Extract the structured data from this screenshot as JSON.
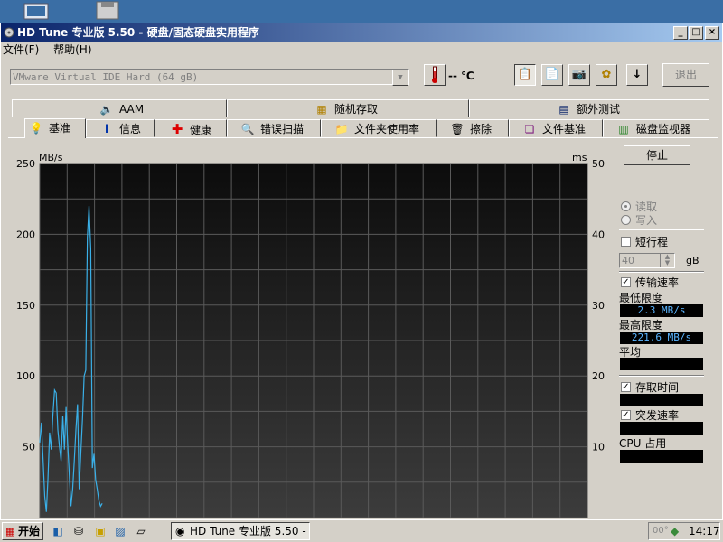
{
  "app": {
    "title": "HD Tune 专业版 5.50 - 硬盘/固态硬盘实用程序"
  },
  "menu": [
    "文件(F)",
    "帮助(H)"
  ],
  "toolbar": {
    "drive": "VMware Virtual IDE Hard (64 gB)",
    "temperature": "-- ℃",
    "exit_label": "退出"
  },
  "tabs_top": [
    {
      "label": "AAM",
      "icon": "speaker-icon"
    },
    {
      "label": "随机存取",
      "icon": "random-access-icon"
    },
    {
      "label": "额外测试",
      "icon": "extra-tests-icon"
    }
  ],
  "tabs_bottom": [
    {
      "label": "基准",
      "icon": "lightbulb-icon",
      "active": true
    },
    {
      "label": "信息",
      "icon": "info-icon"
    },
    {
      "label": "健康",
      "icon": "health-cross-icon"
    },
    {
      "label": "错误扫描",
      "icon": "magnifier-icon"
    },
    {
      "label": "文件夹使用率",
      "icon": "folder-icon"
    },
    {
      "label": "擦除",
      "icon": "trash-icon"
    },
    {
      "label": "文件基准",
      "icon": "file-benchmark-icon"
    },
    {
      "label": "磁盘监视器",
      "icon": "disk-monitor-icon"
    }
  ],
  "right_panel": {
    "stop_label": "停止",
    "read_label": "读取",
    "write_label": "写入",
    "short_stroke_label": "短行程",
    "short_stroke_value": "40",
    "short_stroke_unit": "gB",
    "transfer_rate_label": "传输速率",
    "min_label": "最低限度",
    "min_value": "2.3 MB/s",
    "max_label": "最高限度",
    "max_value": "221.6 MB/s",
    "avg_label": "平均",
    "avg_value": "",
    "access_time_label": "存取时间",
    "access_time_value": "",
    "burst_rate_label": "突发速率",
    "burst_rate_value": "",
    "cpu_label": "CPU 占用",
    "cpu_value": ""
  },
  "chart_data": {
    "type": "line",
    "ylabel_left": "MB/s",
    "ylabel_right": "ms",
    "ylim_left": [
      0,
      250
    ],
    "ylim_right": [
      0,
      50
    ],
    "yticks_left": [
      "250",
      "200",
      "150",
      "100",
      "50"
    ],
    "yticks_right": [
      "50",
      "40",
      "30",
      "20",
      "10"
    ],
    "grid": true,
    "series": [
      {
        "color": "#3ab0e8",
        "x": [
          0,
          0.3,
          0.6,
          0.9,
          1.2,
          1.5,
          1.8,
          2.1,
          2.4,
          2.7,
          3.0,
          3.3,
          3.6,
          3.9,
          4.2,
          4.5,
          4.8,
          5.1,
          5.4,
          5.7,
          6.0,
          6.3,
          6.6,
          6.9,
          7.2,
          7.5,
          7.8,
          8.1,
          8.4,
          8.7,
          9.0,
          9.3,
          9.6,
          9.9,
          10.2,
          10.5,
          10.8,
          11.1,
          11.4
        ],
        "values": [
          53,
          67,
          42,
          15,
          4,
          28,
          60,
          48,
          72,
          90,
          88,
          62,
          50,
          40,
          72,
          48,
          78,
          52,
          30,
          8,
          20,
          40,
          62,
          80,
          20,
          45,
          70,
          100,
          104,
          198,
          220,
          190,
          35,
          45,
          27,
          20,
          12,
          8,
          10
        ]
      }
    ]
  },
  "taskbar": {
    "start_label": "开始",
    "task_label": "HD Tune 专业版 5.50 - ...",
    "tray_temp": "00°",
    "clock": "14:17"
  }
}
